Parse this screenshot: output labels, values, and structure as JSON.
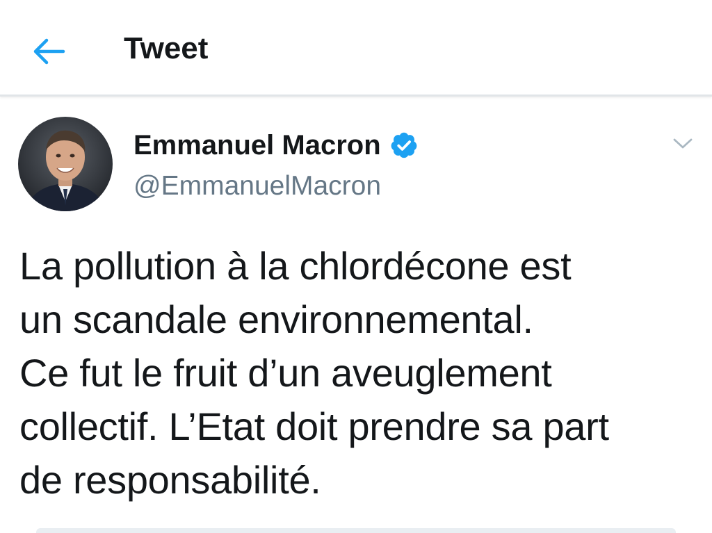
{
  "header": {
    "title": "Tweet",
    "back_icon": "arrow-left-icon",
    "accent_color": "#1da1f2"
  },
  "tweet": {
    "author": {
      "name": "Emmanuel Macron",
      "handle": "@EmmanuelMacron",
      "verified": true,
      "verified_icon": "verified-badge-icon",
      "avatar": "avatar-photo"
    },
    "menu_icon": "chevron-down-icon",
    "text_lines": [
      "La pollution à la chlordécone est",
      "un scandale environnemental.",
      "Ce fut le fruit d’un aveuglement",
      "collectif. L’Etat doit prendre sa part",
      "de responsabilité."
    ]
  },
  "colors": {
    "text_primary": "#14171a",
    "text_secondary": "#657786",
    "verified_blue": "#1da1f2",
    "divider": "#e1e5e8"
  }
}
